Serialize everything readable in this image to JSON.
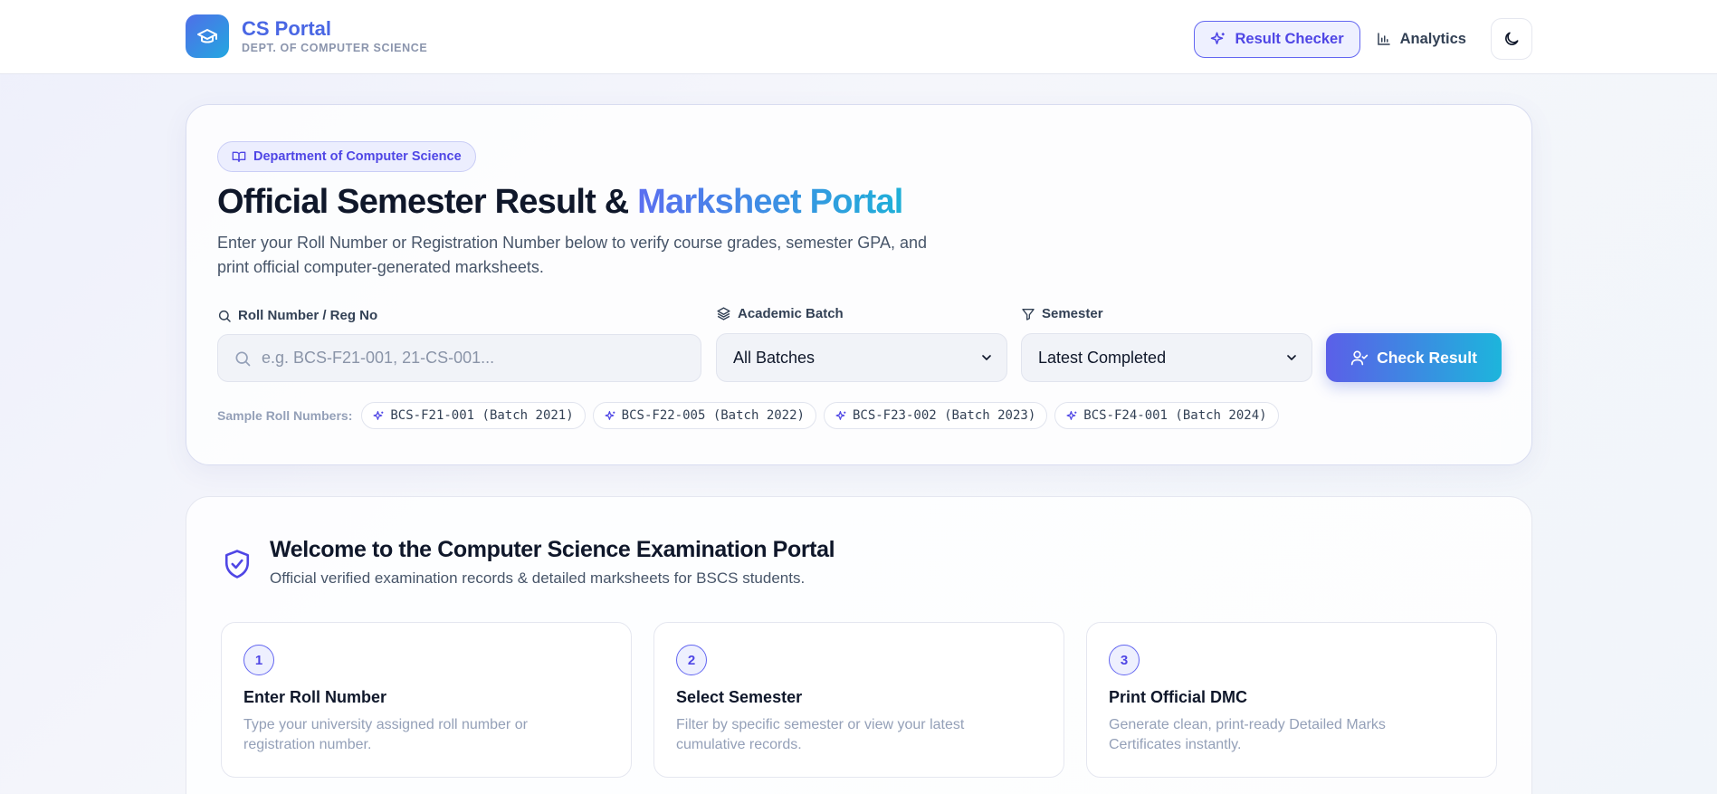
{
  "header": {
    "brand_name": "CS Portal",
    "brand_sub": "DEPT. OF COMPUTER SCIENCE",
    "nav": [
      {
        "label": "Result Checker",
        "icon": "sparkles-icon",
        "active": true
      },
      {
        "label": "Analytics",
        "icon": "bar-chart-icon",
        "active": false
      }
    ],
    "theme_icon": "moon-icon"
  },
  "hero": {
    "tag": "Department of Computer Science",
    "title_main": "Official Semester Result & ",
    "title_accent": "Marksheet Portal",
    "description": "Enter your Roll Number or Registration Number below to verify course grades, semester GPA, and print official computer-generated marksheets.",
    "roll_label": "Roll Number / Reg No",
    "roll_placeholder": "e.g. BCS-F21-001, 21-CS-001...",
    "batch_label": "Academic Batch",
    "batch_value": "All Batches",
    "semester_label": "Semester",
    "semester_value": "Latest Completed",
    "check_button": "Check Result",
    "samples_label": "Sample Roll Numbers:",
    "samples": [
      "BCS-F21-001 (Batch 2021)",
      "BCS-F22-005 (Batch 2022)",
      "BCS-F23-002 (Batch 2023)",
      "BCS-F24-001 (Batch 2024)"
    ]
  },
  "welcome": {
    "title": "Welcome to the Computer Science Examination Portal",
    "subtitle": "Official verified examination records & detailed marksheets for BSCS students.",
    "steps": [
      {
        "num": "1",
        "title": "Enter Roll Number",
        "desc": "Type your university assigned roll number or registration number."
      },
      {
        "num": "2",
        "title": "Select Semester",
        "desc": "Filter by specific semester or view your latest cumulative records."
      },
      {
        "num": "3",
        "title": "Print Official DMC",
        "desc": "Generate clean, print-ready Detailed Marks Certificates instantly."
      }
    ]
  },
  "colors": {
    "accent": "#4f46e5",
    "brand_blue": "#4a67e4",
    "gradient_start": "#5b5fe8",
    "gradient_end": "#1db5dc"
  }
}
